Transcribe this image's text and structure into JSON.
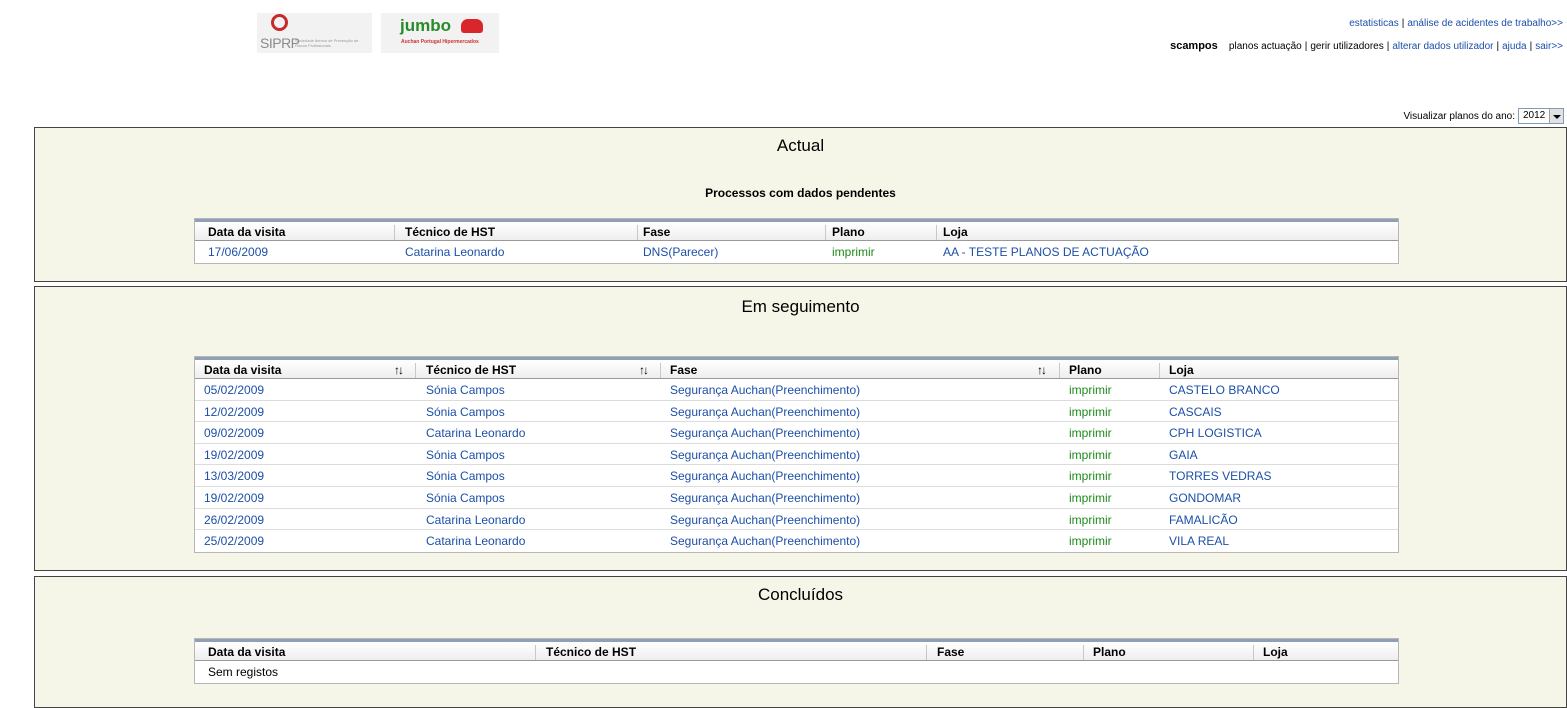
{
  "logos": {
    "siprp_text": "SIPRP",
    "siprp_sub": "Sociedade Ibérica de Prevenção de Riscos Profissionais",
    "jumbo_text": "jumbo",
    "jumbo_sub": "Auchan Portugal Hipermercados"
  },
  "top_links": {
    "estatisticas": "estatisticas",
    "analise": "análise de acidentes de trabalho>>"
  },
  "nav": {
    "current": "scampos",
    "planos": "planos actuação",
    "gerir": "gerir utilizadores",
    "alterar": "alterar dados utilizador",
    "ajuda": "ajuda",
    "sair": "sair>>"
  },
  "year_selector": {
    "label": "Visualizar planos do ano:",
    "value": "2012"
  },
  "headers": [
    "Data da visita",
    "Técnico de HST",
    "Fase",
    "Plano",
    "Loja"
  ],
  "actual": {
    "title": "Actual",
    "subtitle": "Processos com dados pendentes",
    "rows": [
      {
        "data": "17/06/2009",
        "tecnico": "Catarina Leonardo",
        "fase": "DNS(Parecer)",
        "plano": "imprimir",
        "loja": "AA - TESTE PLANOS DE ACTUAÇÃO"
      }
    ]
  },
  "seguimento": {
    "title": "Em seguimento",
    "rows": [
      {
        "data": "05/02/2009",
        "tecnico": "Sónia Campos",
        "fase": "Segurança Auchan(Preenchimento)",
        "plano": "imprimir",
        "loja": "CASTELO BRANCO"
      },
      {
        "data": "12/02/2009",
        "tecnico": "Sónia Campos",
        "fase": "Segurança Auchan(Preenchimento)",
        "plano": "imprimir",
        "loja": "CASCAIS"
      },
      {
        "data": "09/02/2009",
        "tecnico": "Catarina Leonardo",
        "fase": "Segurança Auchan(Preenchimento)",
        "plano": "imprimir",
        "loja": "CPH LOGISTICA"
      },
      {
        "data": "19/02/2009",
        "tecnico": "Sónia Campos",
        "fase": "Segurança Auchan(Preenchimento)",
        "plano": "imprimir",
        "loja": "GAIA"
      },
      {
        "data": "13/03/2009",
        "tecnico": "Sónia Campos",
        "fase": "Segurança Auchan(Preenchimento)",
        "plano": "imprimir",
        "loja": "TORRES VEDRAS"
      },
      {
        "data": "19/02/2009",
        "tecnico": "Sónia Campos",
        "fase": "Segurança Auchan(Preenchimento)",
        "plano": "imprimir",
        "loja": "GONDOMAR"
      },
      {
        "data": "26/02/2009",
        "tecnico": "Catarina Leonardo",
        "fase": "Segurança Auchan(Preenchimento)",
        "plano": "imprimir",
        "loja": "FAMALICÃO"
      },
      {
        "data": "25/02/2009",
        "tecnico": "Catarina Leonardo",
        "fase": "Segurança Auchan(Preenchimento)",
        "plano": "imprimir",
        "loja": "VILA REAL"
      }
    ]
  },
  "concluidos": {
    "title": "Concluídos",
    "empty_text": "Sem registos"
  },
  "colors": {
    "link": "#1c4fa8",
    "print": "#1d8a1d",
    "section_bg": "#f5f5e8"
  }
}
